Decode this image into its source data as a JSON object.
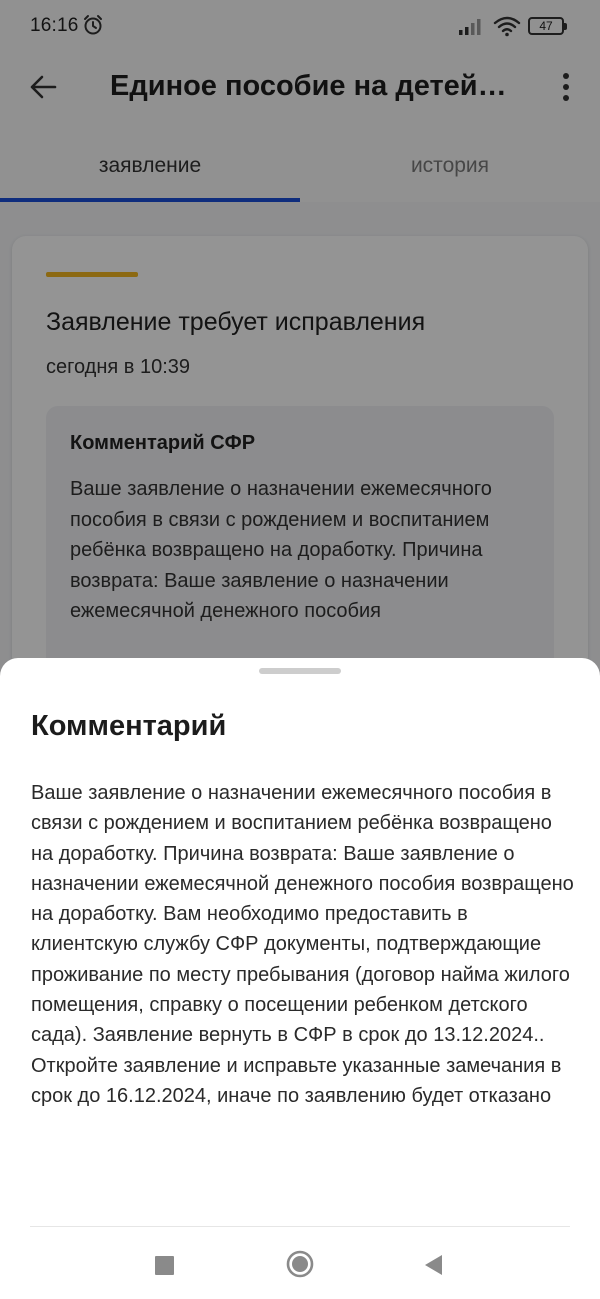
{
  "status_bar": {
    "time": "16:16",
    "battery": "47",
    "icons": [
      "alarm-icon",
      "signal-icon",
      "wifi-icon",
      "battery-icon"
    ]
  },
  "app_bar": {
    "title": "Единое пособие на детей…",
    "back_icon": "arrow-left-icon",
    "menu_icon": "more-vertical-icon"
  },
  "tabs": [
    {
      "label": "заявление",
      "active": true
    },
    {
      "label": "история",
      "active": false
    }
  ],
  "card": {
    "title": "Заявление требует исправления",
    "time": "сегодня в 10:39",
    "comment_title": "Комментарий СФР",
    "comment_text": "Ваше заявление о назначении ежемесячного пособия в связи с рождением и воспитанием ребёнка возвращено на доработку. Причина возврата: Ваше заявление о назначении ежемесячной денежного пособия"
  },
  "sheet": {
    "title": "Комментарий",
    "text": "Ваше заявление о назначении ежемесячного пособия в связи с рождением и воспитанием ребёнка возвращено на доработку. Причина возврата: Ваше заявление о назначении ежемесячной денежного пособия возвращено на доработку. Вам необходимо предоставить в клиентскую службу СФР документы, подтверждающие проживание по месту пребывания (договор найма жилого помещения, справку о посещении ребенком детского сада). Заявление вернуть в СФР в срок до 13.12.2024.. Откройте заявление и исправьте указанные замечания в срок до 16.12.2024, иначе по заявлению будет отказано"
  },
  "nav_bar": {
    "icons": [
      "recents-square-icon",
      "home-circle-icon",
      "back-triangle-icon"
    ]
  },
  "colors": {
    "accent_blue": "#1a4fd8",
    "status_yellow": "#f2b51f"
  }
}
